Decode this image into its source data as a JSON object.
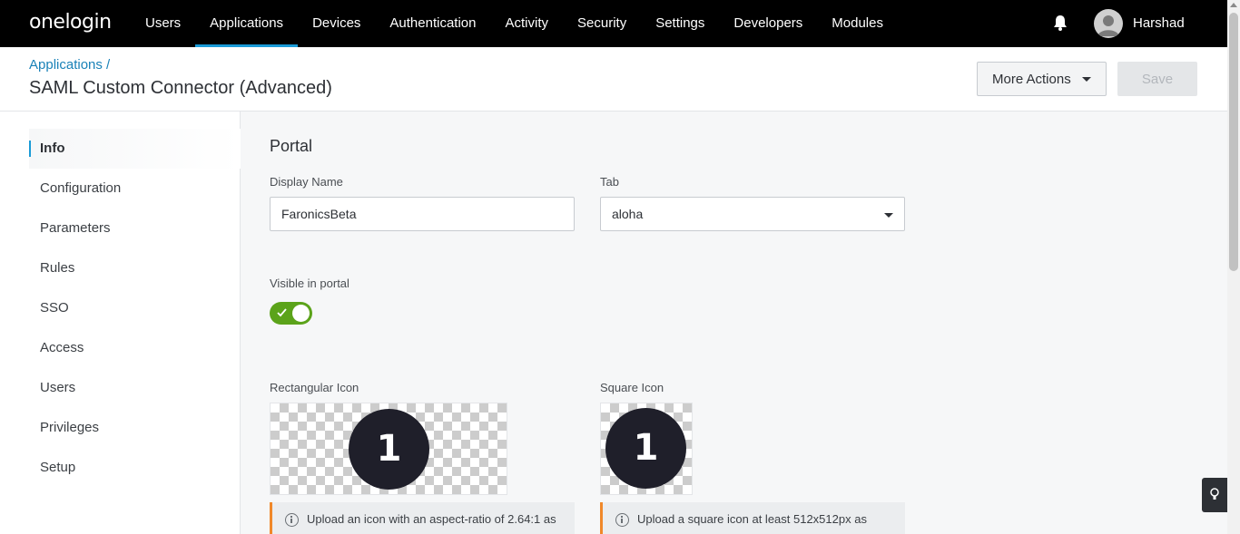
{
  "nav": {
    "logo": "onelogin",
    "items": [
      "Users",
      "Applications",
      "Devices",
      "Authentication",
      "Activity",
      "Security",
      "Settings",
      "Developers",
      "Modules"
    ],
    "active": "Applications",
    "user": "Harshad"
  },
  "header": {
    "breadcrumb": "Applications /",
    "title": "SAML Custom Connector (Advanced)",
    "more_actions": "More Actions",
    "save": "Save"
  },
  "sidebar": {
    "items": [
      "Info",
      "Configuration",
      "Parameters",
      "Rules",
      "SSO",
      "Access",
      "Users",
      "Privileges",
      "Setup"
    ],
    "active": "Info"
  },
  "portal": {
    "section_title": "Portal",
    "display_name_label": "Display Name",
    "display_name_value": "FaronicsBeta",
    "tab_label": "Tab",
    "tab_value": "aloha",
    "visible_label": "Visible in portal",
    "visible": true,
    "rect_icon_label": "Rectangular Icon",
    "square_icon_label": "Square Icon",
    "icon_glyph": "1",
    "rect_info": "Upload an icon with an aspect-ratio of 2.64:1 as",
    "square_info": "Upload a square icon at least 512x512px as"
  },
  "colors": {
    "accent": "#1a9bd7",
    "toggle_on": "#5ba31a",
    "warning": "#f0882a"
  }
}
